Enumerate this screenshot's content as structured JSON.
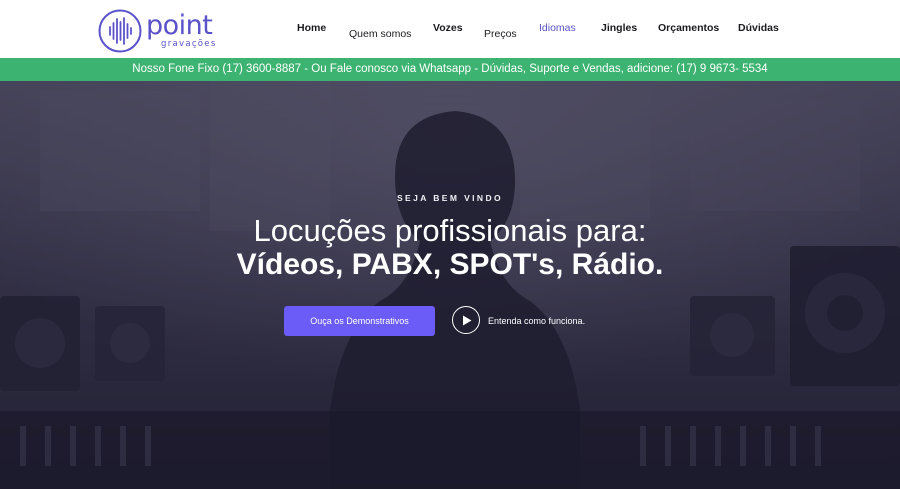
{
  "brand": {
    "name": "point",
    "subtitle": "gravações",
    "color": "#5b52c9"
  },
  "nav": {
    "items": [
      {
        "label": "Home"
      },
      {
        "label": "Quem somos"
      },
      {
        "label": "Vozes"
      },
      {
        "label": "Preços"
      },
      {
        "label": "Idiomas"
      },
      {
        "label": "Jingles"
      },
      {
        "label": "Orçamentos"
      },
      {
        "label": "Dúvidas"
      }
    ],
    "active_label": "Idiomas"
  },
  "info_bar": {
    "text": "Nosso Fone Fixo (17) 3600-8887 - Ou Fale conosco via Whatsapp - Dúvidas, Suporte e Vendas, adicione: (17) 9 9673- 5534",
    "color": "#3cb371"
  },
  "hero": {
    "eyebrow": "SEJA BEM VINDO",
    "headline": "Locuções profissionais para:",
    "headline_strong": "Vídeos, PABX, SPOT's, Rádio.",
    "cta_label": "Ouça os Demonstrativos",
    "cta_color": "#6b5cf7",
    "play_icon": "play-icon",
    "play_label": "Entenda como funciona."
  }
}
